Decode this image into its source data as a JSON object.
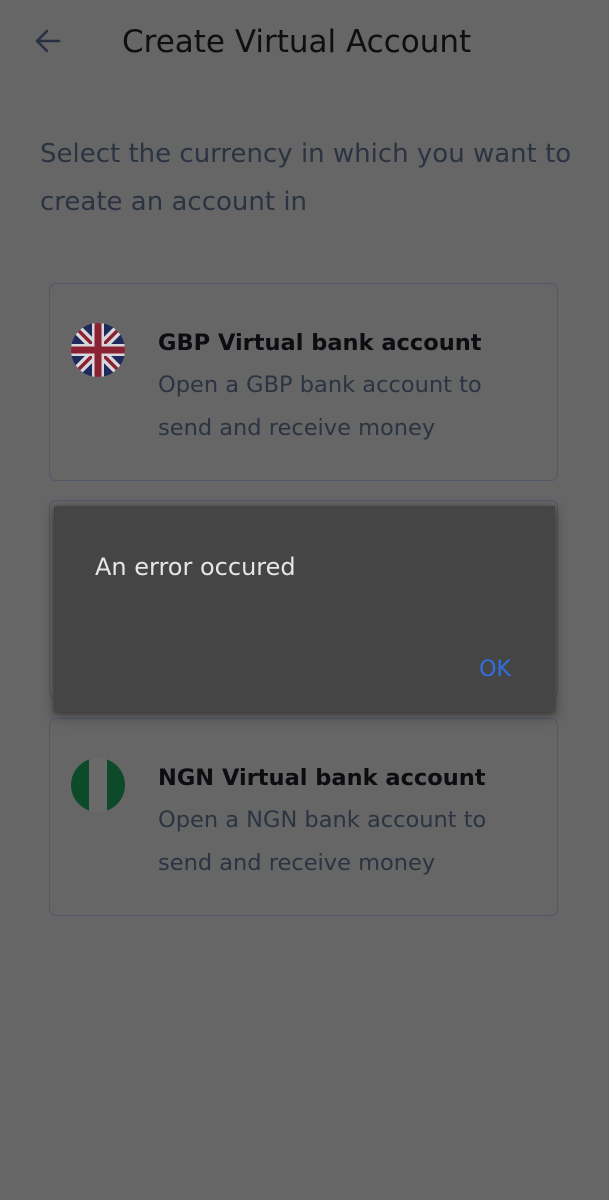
{
  "header": {
    "back_icon": "arrow-left-icon",
    "title": "Create Virtual Account"
  },
  "subtitle": "Select the currency in which you want to create an account in",
  "accounts": [
    {
      "flag_icon": "uk-flag-icon",
      "title": "GBP Virtual bank account",
      "description": "Open a GBP bank account to send and receive money"
    },
    {
      "flag_icon": "nigeria-flag-icon",
      "title": "NGN Virtual bank account",
      "description": "Open a NGN bank account to send and receive money"
    }
  ],
  "dialog": {
    "message": "An error occured",
    "ok_label": "OK"
  },
  "colors": {
    "background_dimmed": "#666666",
    "dialog_background": "#454545",
    "dialog_accent": "#2f6fe0"
  }
}
